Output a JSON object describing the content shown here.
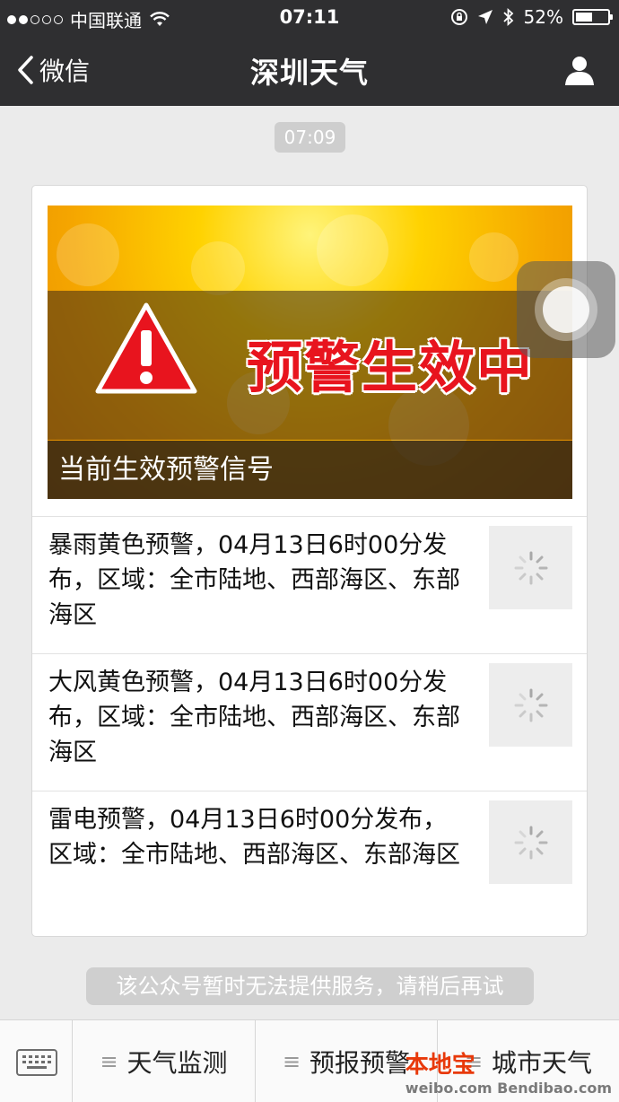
{
  "status_bar": {
    "carrier": "中国联通",
    "time": "07:11",
    "battery": "52%",
    "battery_level": 0.52
  },
  "nav": {
    "back_label": "微信",
    "title": "深圳天气"
  },
  "chat": {
    "timestamp": "07:09"
  },
  "card": {
    "banner_headline": "预警生效中",
    "banner_caption": "当前生效预警信号",
    "items": [
      {
        "text": "暴雨黄色预警，04月13日6时00分发布，区域：全市陆地、西部海区、东部海区"
      },
      {
        "text": "大风黄色预警，04月13日6时00分发布，区域：全市陆地、西部海区、东部海区"
      },
      {
        "text": "雷电预警，04月13日6时00分发布，区域：全市陆地、西部海区、东部海区"
      }
    ]
  },
  "notice": "该公众号暂时无法提供服务，请稍后再试",
  "menu": {
    "items": [
      {
        "label": "天气监测"
      },
      {
        "label": "预报预警"
      },
      {
        "label": "城市天气"
      }
    ]
  },
  "watermark": {
    "brand": "本地宝",
    "site": "weibo.com  Bendibao.com"
  },
  "colors": {
    "bar_bg": "#2f2f31",
    "page_bg": "#ebebeb",
    "warning_red": "#e8141e",
    "banner_yellow": "#ffd200"
  }
}
